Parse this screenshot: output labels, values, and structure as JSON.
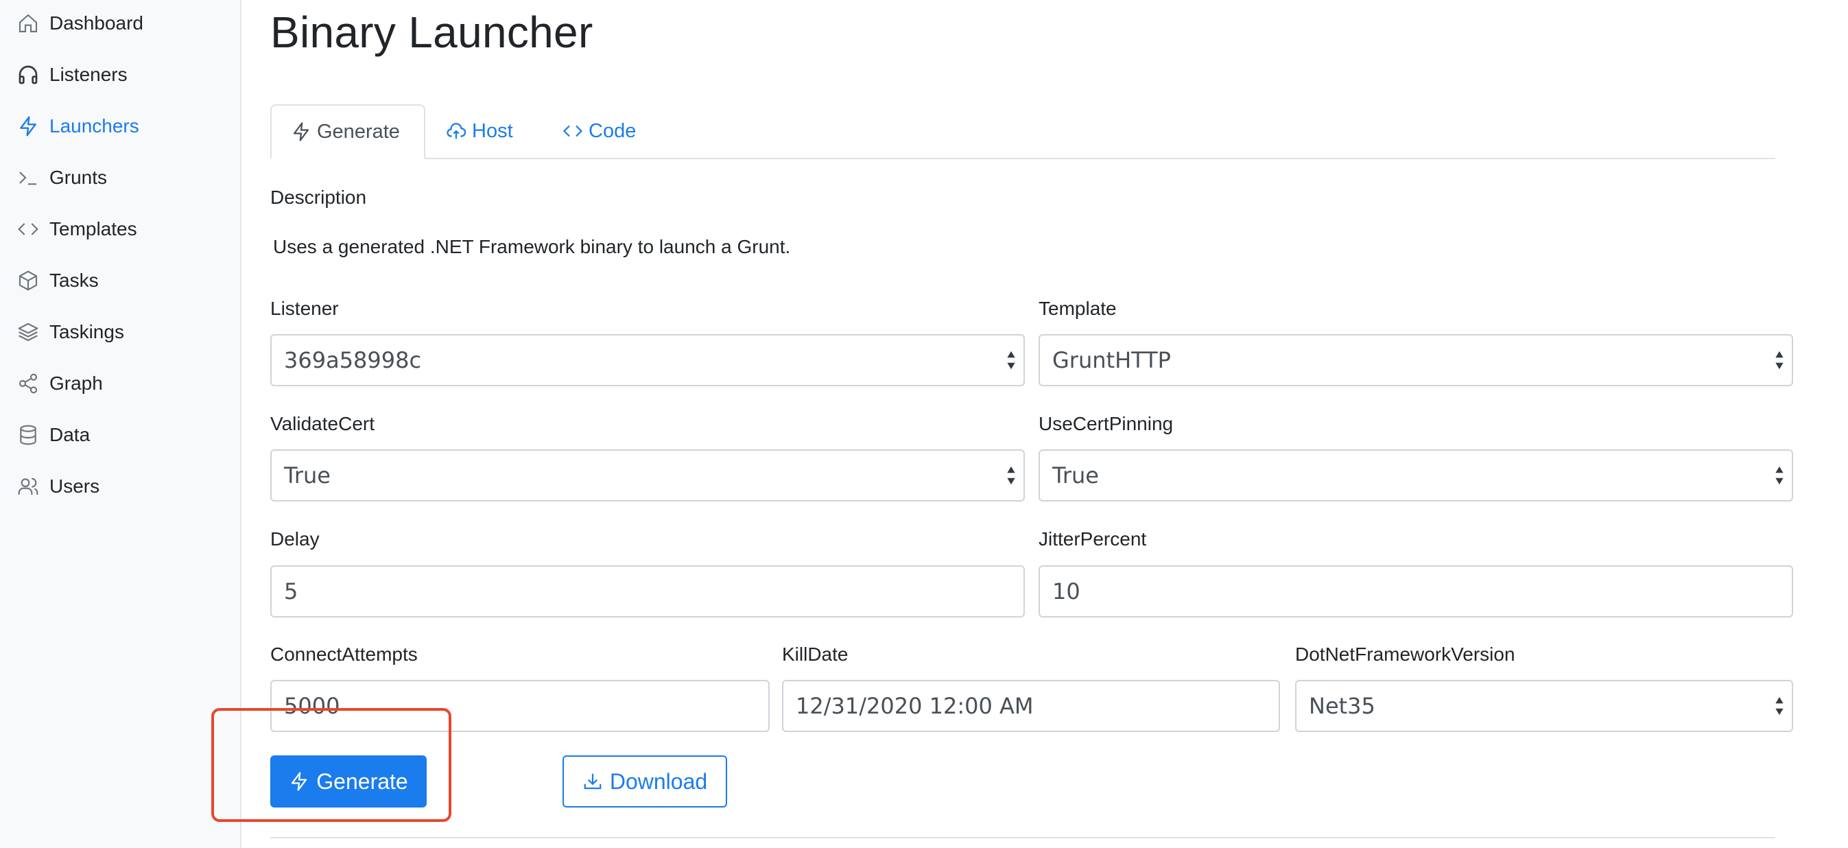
{
  "sidebar": {
    "items": [
      {
        "label": "Dashboard",
        "icon": "home-icon",
        "active": false
      },
      {
        "label": "Listeners",
        "icon": "headphones-icon",
        "active": false
      },
      {
        "label": "Launchers",
        "icon": "lightning-icon",
        "active": true
      },
      {
        "label": "Grunts",
        "icon": "terminal-icon",
        "active": false
      },
      {
        "label": "Templates",
        "icon": "code-icon",
        "active": false
      },
      {
        "label": "Tasks",
        "icon": "box-icon",
        "active": false
      },
      {
        "label": "Taskings",
        "icon": "layers-icon",
        "active": false
      },
      {
        "label": "Graph",
        "icon": "share-icon",
        "active": false
      },
      {
        "label": "Data",
        "icon": "database-icon",
        "active": false
      },
      {
        "label": "Users",
        "icon": "users-icon",
        "active": false
      }
    ]
  },
  "page": {
    "title": "Binary Launcher"
  },
  "tabs": [
    {
      "label": "Generate",
      "icon": "lightning-icon",
      "active": true
    },
    {
      "label": "Host",
      "icon": "cloud-upload-icon",
      "active": false
    },
    {
      "label": "Code",
      "icon": "code-icon",
      "active": false
    }
  ],
  "description": {
    "label": "Description",
    "text": "Uses a generated .NET Framework binary to launch a Grunt."
  },
  "form": {
    "listener": {
      "label": "Listener",
      "value": "369a58998c"
    },
    "template": {
      "label": "Template",
      "value": "GruntHTTP"
    },
    "validate_cert": {
      "label": "ValidateCert",
      "value": "True"
    },
    "use_cert_pinning": {
      "label": "UseCertPinning",
      "value": "True"
    },
    "delay": {
      "label": "Delay",
      "value": "5"
    },
    "jitter_percent": {
      "label": "JitterPercent",
      "value": "10"
    },
    "connect_attempts": {
      "label": "ConnectAttempts",
      "value": "5000"
    },
    "kill_date": {
      "label": "KillDate",
      "value": "12/31/2020 12:00 AM"
    },
    "dotnet_version": {
      "label": "DotNetFrameworkVersion",
      "value": "Net35"
    }
  },
  "actions": {
    "generate_label": "Generate",
    "download_label": "Download"
  },
  "colors": {
    "accent": "#1b7ced",
    "highlight": "#e8472c",
    "sidebar_bg": "#f8f9fa",
    "border": "#ced4da"
  }
}
